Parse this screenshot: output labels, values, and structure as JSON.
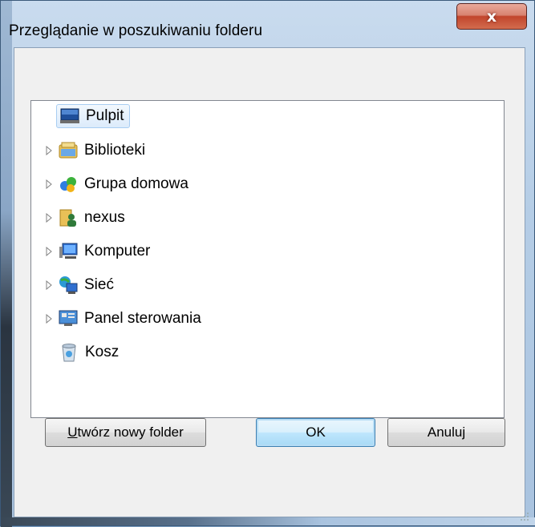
{
  "window": {
    "title": "Przeglądanie w poszukiwaniu folderu",
    "close_glyph": "x"
  },
  "tree": {
    "items": [
      {
        "label": "Pulpit",
        "icon": "desktop-icon",
        "expandable": false,
        "selected": true
      },
      {
        "label": "Biblioteki",
        "icon": "libraries-icon",
        "expandable": true
      },
      {
        "label": "Grupa domowa",
        "icon": "homegroup-icon",
        "expandable": true
      },
      {
        "label": "nexus",
        "icon": "user-folder-icon",
        "expandable": true
      },
      {
        "label": "Komputer",
        "icon": "computer-icon",
        "expandable": true
      },
      {
        "label": "Sieć",
        "icon": "network-icon",
        "expandable": true
      },
      {
        "label": "Panel sterowania",
        "icon": "control-panel-icon",
        "expandable": true
      },
      {
        "label": "Kosz",
        "icon": "recycle-bin-icon",
        "expandable": false
      }
    ]
  },
  "buttons": {
    "new_folder_accel": "U",
    "new_folder_rest": "twórz nowy folder",
    "ok": "OK",
    "cancel": "Anuluj"
  },
  "colors": {
    "selection": "#dcebfb",
    "close": "#c2452c",
    "default_button": "#bee6fd"
  }
}
